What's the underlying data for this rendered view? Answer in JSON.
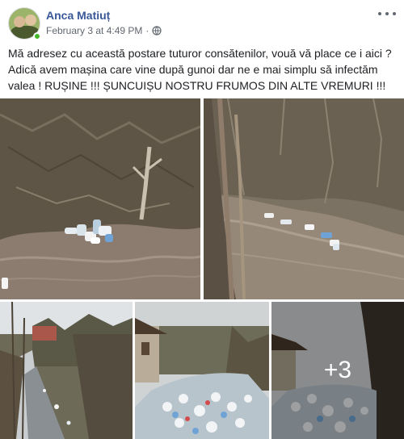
{
  "post": {
    "author": "Anca Matiuț",
    "timestamp": "February 3 at 4:49 PM",
    "separator": "·",
    "privacy_icon": "globe-icon",
    "menu_icon": "more-icon",
    "text_line1": "Mă adresez cu această postare tuturor consătenilor, vouă vă place ce i aici ?",
    "text_line2": "Adică avem mașina care vine după gunoi dar ne e mai simplu să infectăm valea ! RUȘINE !!! ȘUNCUIȘU NOSTRU FRUMOS DIN ALTE VREMURI !!!"
  },
  "photos": {
    "extra_count": "+3"
  },
  "colors": {
    "author": "#385898",
    "meta": "#616770",
    "online": "#42b72a"
  }
}
